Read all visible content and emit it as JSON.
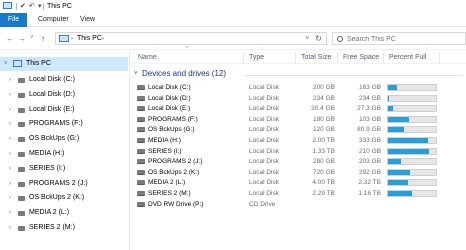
{
  "window": {
    "title": "This PC",
    "quick_access": {
      "properties_glyph": "✔",
      "undo_glyph": "↶",
      "dropdown_glyph": "▾"
    }
  },
  "ribbon": {
    "tabs": [
      "File",
      "Computer",
      "View"
    ]
  },
  "address": {
    "back_glyph": "←",
    "forward_glyph": "→",
    "recent_glyph": "˅",
    "up_glyph": "↑",
    "crumb": "This PC",
    "crumb_arrow": "›",
    "dropdown_glyph": "˅",
    "refresh_glyph": "↻"
  },
  "search": {
    "placeholder": "Search This PC"
  },
  "sidebar": {
    "root": {
      "label": "This PC",
      "arrow": "˅"
    },
    "items": [
      {
        "label": "Local Disk (C:)",
        "arrow": "›"
      },
      {
        "label": "Local Disk (D:)",
        "arrow": "›"
      },
      {
        "label": "Local Disk (E:)",
        "arrow": "›"
      },
      {
        "label": "PROGRAMS (F:)",
        "arrow": "›"
      },
      {
        "label": "OS BckUps (G:)",
        "arrow": "›"
      },
      {
        "label": "MEDIA (H:)",
        "arrow": "›"
      },
      {
        "label": "SERIES (I:)",
        "arrow": "›"
      },
      {
        "label": "PROGRAMS 2 (J:)",
        "arrow": "›"
      },
      {
        "label": "OS BckUps 2 (K:)",
        "arrow": "›"
      },
      {
        "label": "MEDIA 2 (L:)",
        "arrow": "›"
      },
      {
        "label": "SERIES 2 (M:)",
        "arrow": "›"
      }
    ]
  },
  "columns": {
    "name": "Name",
    "type": "Type",
    "total": "Total Size",
    "free": "Free Space",
    "percent": "Percent Full",
    "sort_caret": "^"
  },
  "group": {
    "chevron": "˅",
    "title": "Devices and drives (12)"
  },
  "drives": [
    {
      "name": "Local Disk (C:)",
      "type": "Local Disk",
      "total": "200 GB",
      "free": "163 GB",
      "percent_full": 0.19
    },
    {
      "name": "Local Disk (D:)",
      "type": "Local Disk",
      "total": "234 GB",
      "free": "234 GB",
      "percent_full": 0.02
    },
    {
      "name": "Local Disk (E:)",
      "type": "Local Disk",
      "total": "30.4 GB",
      "free": "27.3 GB",
      "percent_full": 0.1
    },
    {
      "name": "PROGRAMS (F:)",
      "type": "Local Disk",
      "total": "180 GB",
      "free": "103 GB",
      "percent_full": 0.43
    },
    {
      "name": "OS BckUps (G:)",
      "type": "Local Disk",
      "total": "120 GB",
      "free": "80.9 GB",
      "percent_full": 0.33
    },
    {
      "name": "MEDIA (H:)",
      "type": "Local Disk",
      "total": "2.00 TB",
      "free": "333 GB",
      "percent_full": 0.84
    },
    {
      "name": "SERIES (I:)",
      "type": "Local Disk",
      "total": "1.33 TB",
      "free": "210 GB",
      "percent_full": 0.85
    },
    {
      "name": "PROGRAMS 2 (J:)",
      "type": "Local Disk",
      "total": "280 GB",
      "free": "203 GB",
      "percent_full": 0.28
    },
    {
      "name": "OS BckUps 2 (K:)",
      "type": "Local Disk",
      "total": "720 GB",
      "free": "392 GB",
      "percent_full": 0.46
    },
    {
      "name": "MEDIA 2 (L:)",
      "type": "Local Disk",
      "total": "4.00 TB",
      "free": "2.32 TB",
      "percent_full": 0.42
    },
    {
      "name": "SERIES 2 (M:)",
      "type": "Local Disk",
      "total": "2.29 TB",
      "free": "1.16 TB",
      "percent_full": 0.49
    },
    {
      "name": "DVD RW Drive (P:)",
      "type": "CD Drive",
      "total": "",
      "free": "",
      "percent_full": null
    }
  ],
  "colors": {
    "accent": "#1979ca",
    "bar_fill": "#26a0da",
    "selected": "#cce8ff",
    "group_title": "#1e3287"
  }
}
